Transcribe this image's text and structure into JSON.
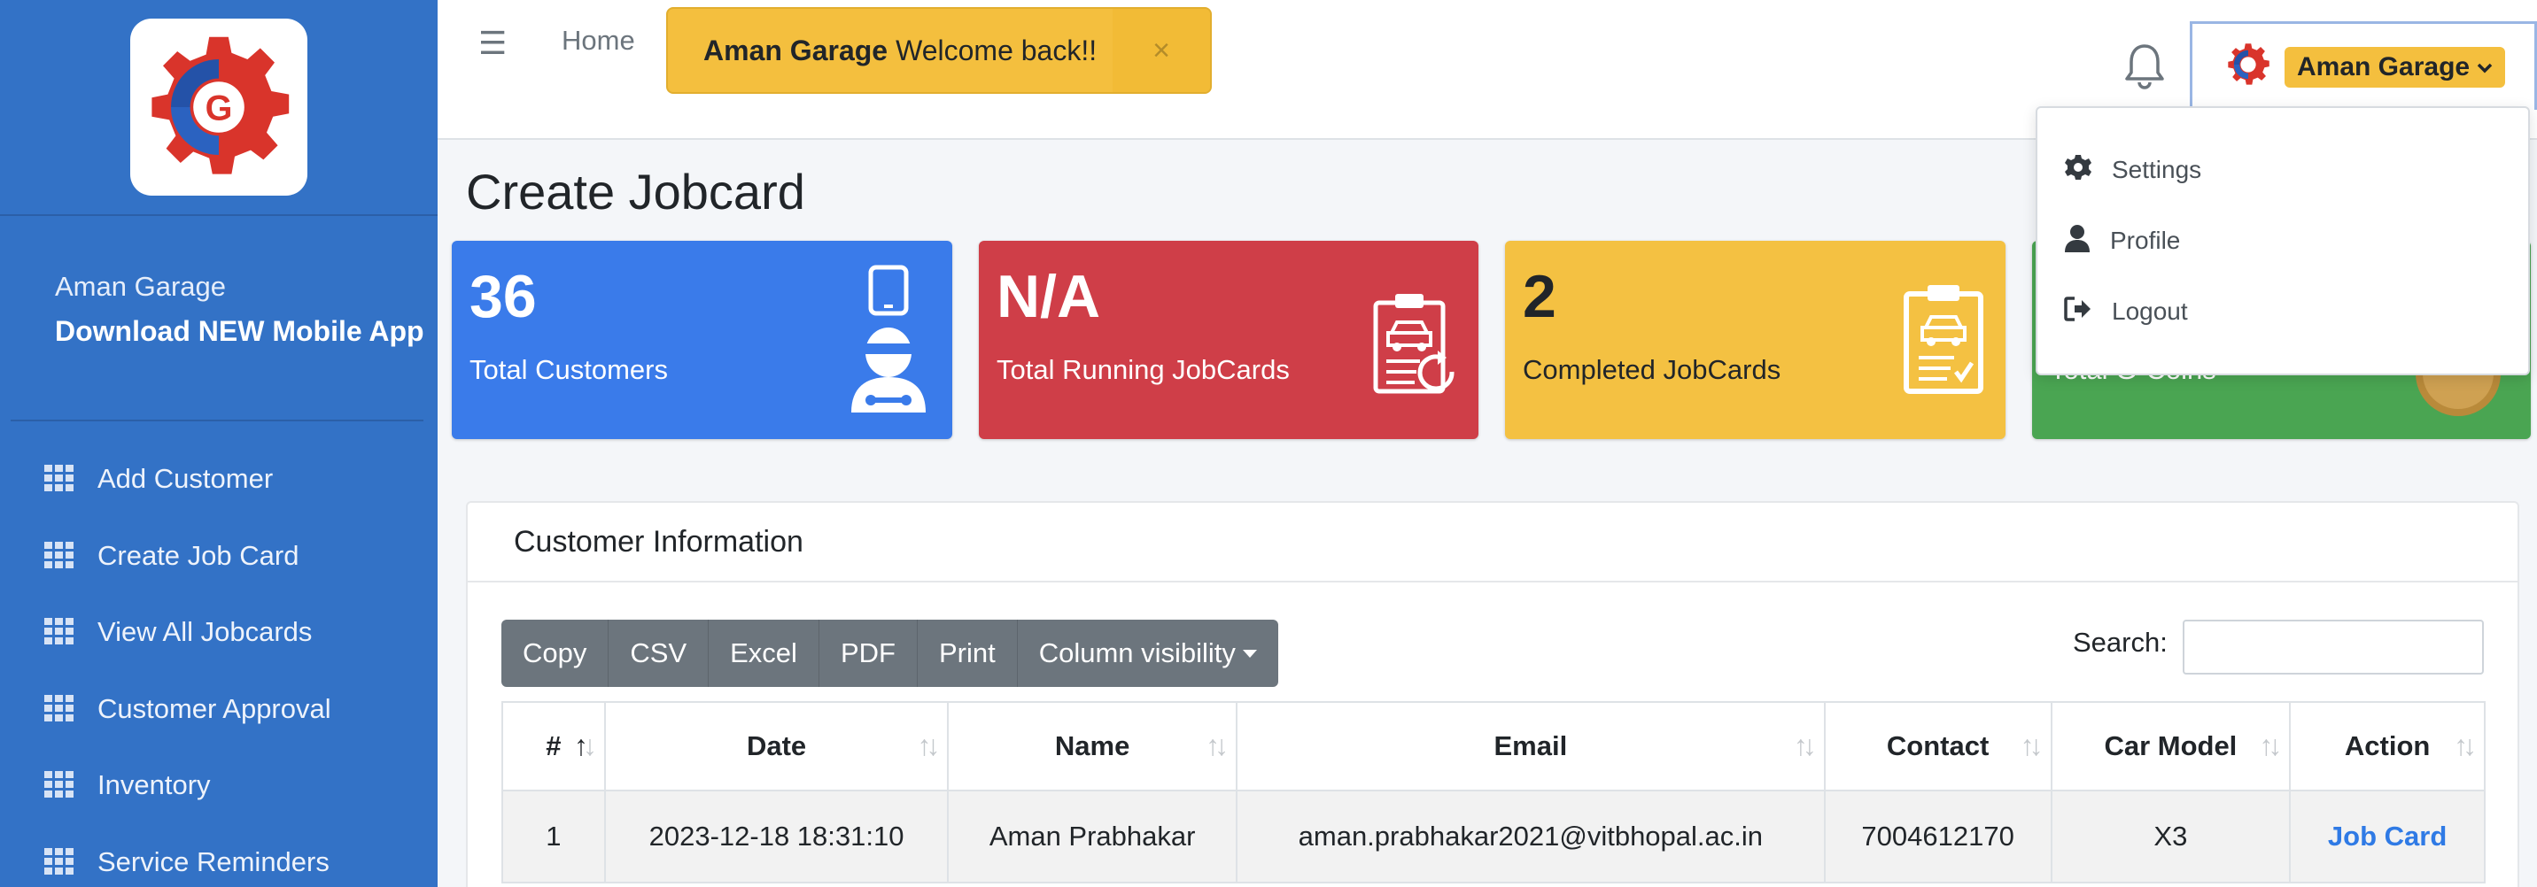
{
  "sidebar": {
    "user_name": "Aman Garage",
    "app_link": "Download NEW Mobile App",
    "items": [
      {
        "label": "Add Customer"
      },
      {
        "label": "Create Job Card"
      },
      {
        "label": "View All Jobcards"
      },
      {
        "label": "Customer Approval"
      },
      {
        "label": "Inventory"
      },
      {
        "label": "Service Reminders"
      }
    ]
  },
  "topbar": {
    "home_label": "Home",
    "alert_bold": "Aman Garage",
    "alert_text": "Welcome back!!",
    "alert_close": "×",
    "user_label": "Aman Garage",
    "chevron": "⌄"
  },
  "dropdown": {
    "items": [
      {
        "label": "Settings",
        "icon": "gear-icon"
      },
      {
        "label": "Profile",
        "icon": "user-icon"
      },
      {
        "label": "Logout",
        "icon": "logout-icon"
      }
    ]
  },
  "page": {
    "title": "Create Jobcard"
  },
  "cards": [
    {
      "value": "36",
      "label": "Total Customers",
      "icon": "customer-icon",
      "color": "#3a7bea"
    },
    {
      "value": "N/A",
      "label": "Total Running JobCards",
      "icon": "running-jobcard-icon",
      "color": "#cf3e48"
    },
    {
      "value": "2",
      "label": "Completed JobCards",
      "icon": "completed-jobcard-icon",
      "color": "#f4c142"
    },
    {
      "value": "",
      "label": "Total G-Coins",
      "icon": "coin-icon",
      "color": "#4aa552"
    }
  ],
  "panel": {
    "title": "Customer Information",
    "buttons": [
      "Copy",
      "CSV",
      "Excel",
      "PDF",
      "Print",
      "Column visibility"
    ],
    "search_label": "Search:",
    "search_value": "",
    "columns": [
      "#",
      "Date",
      "Name",
      "Email",
      "Contact",
      "Car Model",
      "Action"
    ],
    "rows": [
      {
        "num": "1",
        "date": "2023-12-18 18:31:10",
        "name": "Aman Prabhakar",
        "email": "aman.prabhakar2021@vitbhopal.ac.in",
        "contact": "7004612170",
        "car_model": "X3",
        "action": "Job Card"
      }
    ]
  },
  "colors": {
    "sidebar": "#3372c6",
    "warning": "#f4bf3e",
    "link": "#2f7ae5"
  }
}
